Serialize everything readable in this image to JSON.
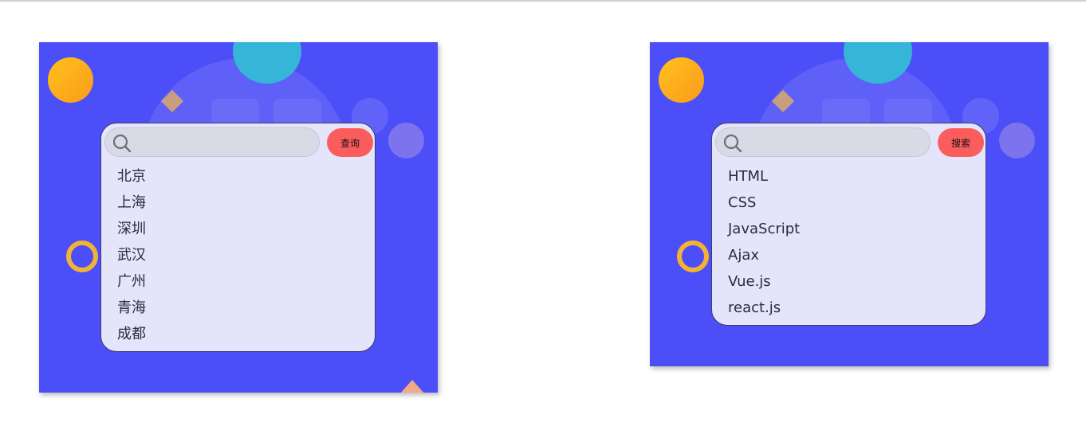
{
  "widgets": [
    {
      "button_label": "查询",
      "input_value": "",
      "results": [
        "北京",
        "上海",
        "深圳",
        "武汉",
        "广州",
        "青海",
        "成都"
      ]
    },
    {
      "button_label": "搜索",
      "input_value": "",
      "results": [
        "HTML",
        "CSS",
        "JavaScript",
        "Ajax",
        "Vue.js",
        "react.js"
      ]
    }
  ],
  "colors": {
    "panel_background": "#4c4ef7",
    "search_box_background": "#e4e5fb",
    "button_background": "#fb5d5d",
    "orange_circle": "#fbab1d",
    "cyan_circle": "#35b5d8",
    "ring": "#f2b335"
  },
  "icons": {
    "search": "search-icon"
  }
}
